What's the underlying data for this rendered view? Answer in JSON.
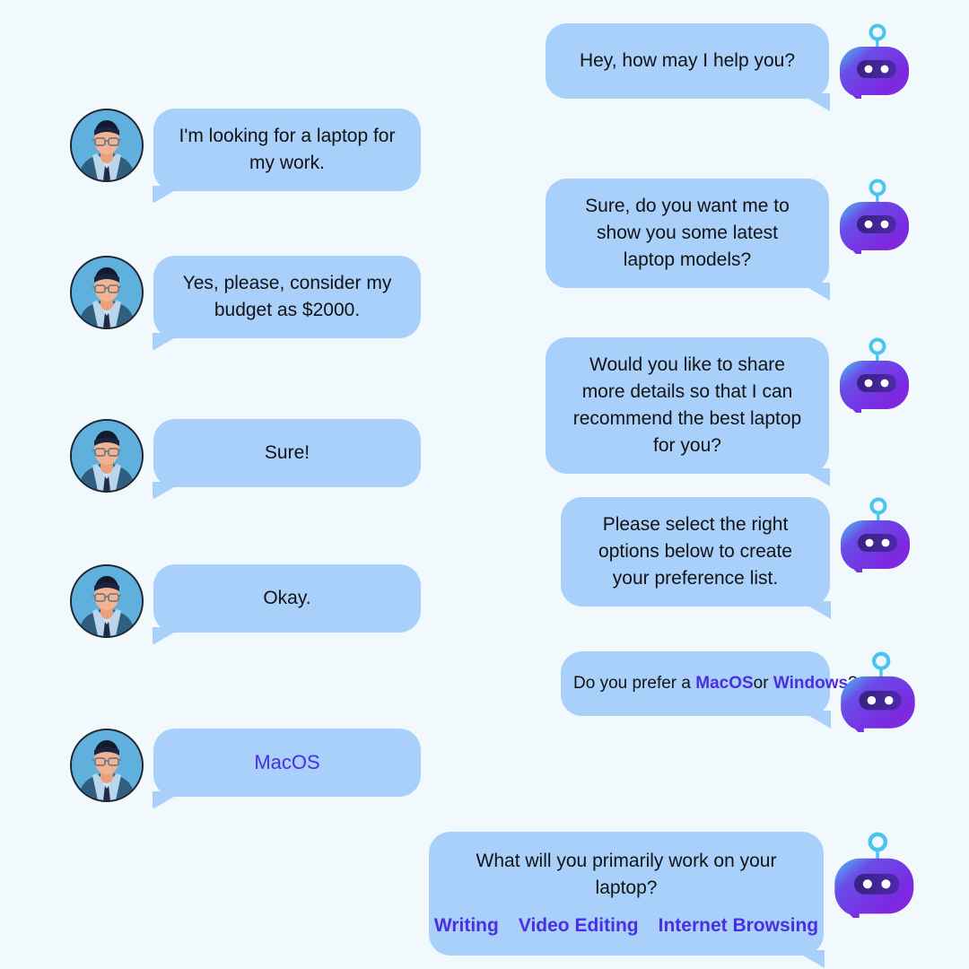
{
  "theme": {
    "background": "#f2f9fd",
    "bubble_fill": "#a8d0fb",
    "text_color": "#131313",
    "option_link_color": "#4c2ee0",
    "bot_avatar_purple": "#6c2bd9",
    "bot_avatar_cyan": "#4bc5ee"
  },
  "conversation": [
    {
      "id": "m1",
      "sender": "bot",
      "text": "Hey, how may I help you?"
    },
    {
      "id": "m2",
      "sender": "user",
      "text": "I'm looking for a laptop for my work."
    },
    {
      "id": "m3",
      "sender": "bot",
      "text": "Sure, do you want me to show you some latest laptop models?"
    },
    {
      "id": "m4",
      "sender": "user",
      "text": "Yes, please, consider my budget as $2000."
    },
    {
      "id": "m5",
      "sender": "bot",
      "text": "Would you like to share more details so that I can recommend the best laptop for you?"
    },
    {
      "id": "m6",
      "sender": "user",
      "text": "Sure!"
    },
    {
      "id": "m7",
      "sender": "bot",
      "text": "Please select the right options below to create your preference list."
    },
    {
      "id": "m8",
      "sender": "user",
      "text": "Okay."
    },
    {
      "id": "m9",
      "sender": "bot",
      "prefix": "Do you prefer a",
      "option_a": "MacOS",
      "separator": "or",
      "option_b": "Windows",
      "suffix": "?"
    },
    {
      "id": "m10",
      "sender": "user",
      "text": "MacOS"
    },
    {
      "id": "m11",
      "sender": "bot",
      "text": "What will you primarily work on your laptop?",
      "options": [
        "Writing",
        "Video Editing",
        "Internet Browsing"
      ]
    }
  ],
  "icons": {
    "user_avatar": "user-avatar-man-glasses-suit",
    "bot_avatar": "bot-avatar-robot-chat-head"
  }
}
